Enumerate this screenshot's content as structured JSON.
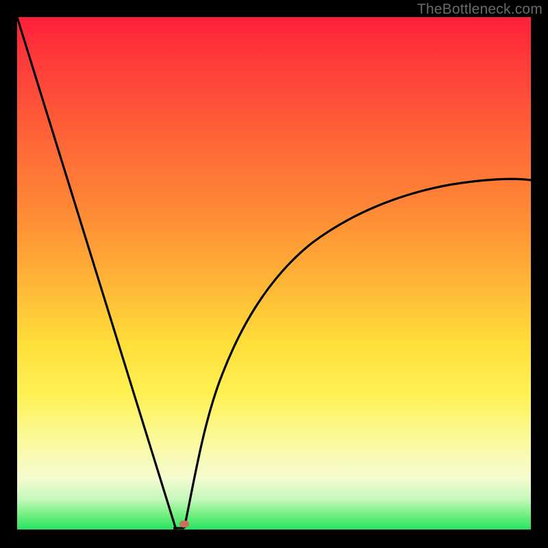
{
  "watermark": "TheBottleneck.com",
  "colors": {
    "frame": "#000000",
    "curve": "#000000",
    "marker": "#cc6f5e",
    "gradient_stops": [
      "#ff1f3a",
      "#ff3a3a",
      "#ff6038",
      "#ff8a36",
      "#ffb636",
      "#ffdf3a",
      "#fff255",
      "#fbfaa0",
      "#f4fbd0",
      "#c6f8bd",
      "#76f083",
      "#26e35e"
    ]
  },
  "chart_data": {
    "type": "line",
    "title": "",
    "xlabel": "",
    "ylabel": "",
    "xlim": [
      0,
      100
    ],
    "ylim": [
      0,
      100
    ],
    "notes": "V-shaped bottleneck curve; minimum near x≈31 at y≈0. Right branch rises with curvature and levels toward ~68.",
    "minimum": {
      "x": 31,
      "y": 0
    },
    "marker": {
      "x": 32.5,
      "y": 1.2
    },
    "series": [
      {
        "name": "curve",
        "x": [
          0,
          4,
          8,
          12,
          16,
          20,
          24,
          27,
          29,
          30,
          31,
          32,
          33,
          34,
          36,
          40,
          45,
          50,
          55,
          60,
          65,
          70,
          75,
          80,
          85,
          90,
          95,
          100
        ],
        "y": [
          100,
          87,
          74,
          61,
          48,
          35,
          22,
          12,
          5,
          2,
          0,
          2,
          5,
          8,
          14,
          24,
          34,
          42,
          48,
          53,
          57,
          60,
          62,
          64,
          65.5,
          66.5,
          67.5,
          68
        ]
      }
    ]
  }
}
